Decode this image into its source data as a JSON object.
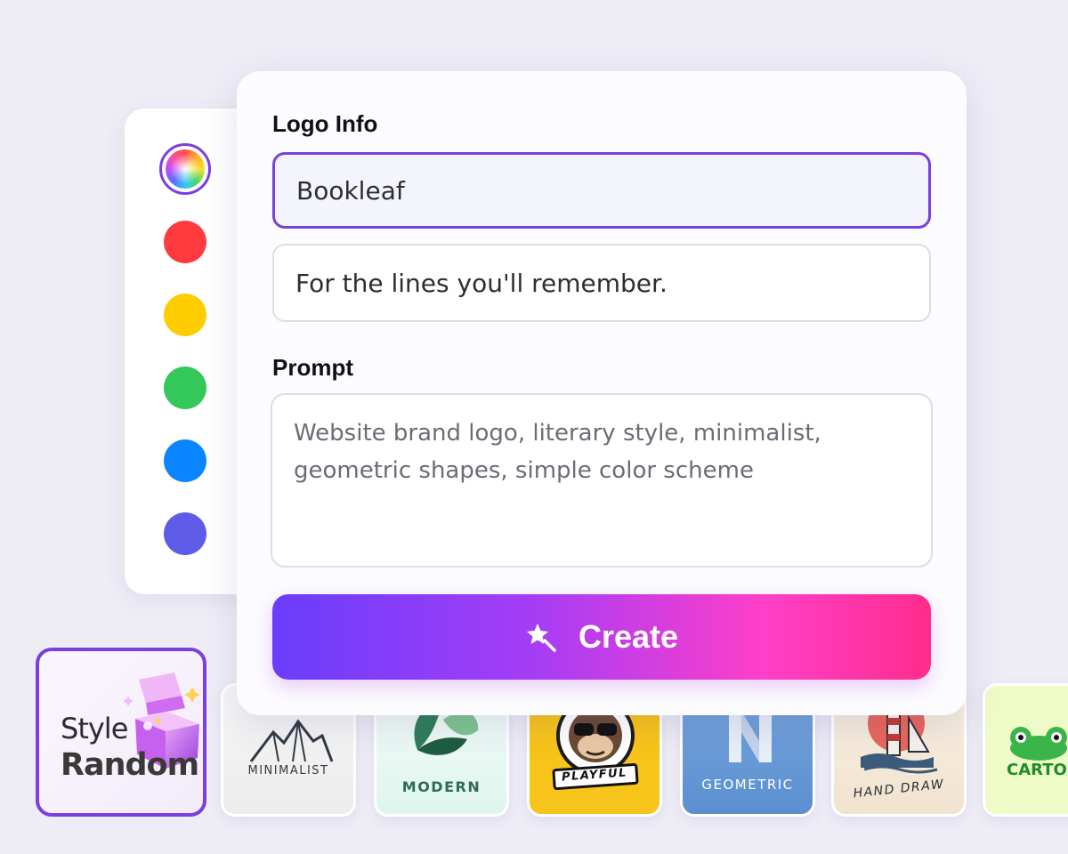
{
  "card": {
    "logo_info_label": "Logo Info",
    "name_value": "Bookleaf",
    "slogan_value": "For the lines you'll remember.",
    "prompt_label": "Prompt",
    "prompt_text": "Website brand logo, literary style, minimalist, geometric shapes, simple color scheme",
    "create_label": "Create",
    "create_icon": "magic-wand-star-icon"
  },
  "palette": {
    "colors": [
      "#rainbow",
      "#ff3b3f",
      "#ffcc00",
      "#34c759",
      "#0a84ff",
      "#5e5ce6"
    ],
    "selected_index": 0
  },
  "styles": [
    {
      "name": "Style Random",
      "line1": "Style",
      "line2": "Random",
      "selected": true
    },
    {
      "name": "MINIMALIST"
    },
    {
      "name": "MODERN"
    },
    {
      "name": "PLAYFUL"
    },
    {
      "name": "GEOMETRIC"
    },
    {
      "name": "HAND DRAW"
    },
    {
      "name": "CARTO"
    }
  ],
  "colors": {
    "accent": "#7b3fe0",
    "button_gradient_start": "#6a3dfc",
    "button_gradient_end": "#ff2d8c"
  }
}
